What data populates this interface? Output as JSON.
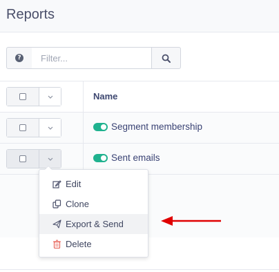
{
  "page": {
    "title": "Reports"
  },
  "toolbar": {
    "help_icon": "question-circle-icon",
    "filter_placeholder": "Filter...",
    "search_icon": "search-icon"
  },
  "table": {
    "header": {
      "name": "Name"
    },
    "rows": [
      {
        "name": "Segment membership",
        "enabled": true
      },
      {
        "name": "Sent emails",
        "enabled": true
      }
    ]
  },
  "dropdown": {
    "items": [
      {
        "label": "Edit",
        "icon": "edit-icon"
      },
      {
        "label": "Clone",
        "icon": "clone-icon"
      },
      {
        "label": "Export & Send",
        "icon": "send-icon"
      },
      {
        "label": "Delete",
        "icon": "trash-icon"
      }
    ]
  },
  "colors": {
    "toggle_on": "#20b28f",
    "delete_icon": "#e8675d",
    "arrow": "#e00000",
    "text": "#3a4374"
  }
}
